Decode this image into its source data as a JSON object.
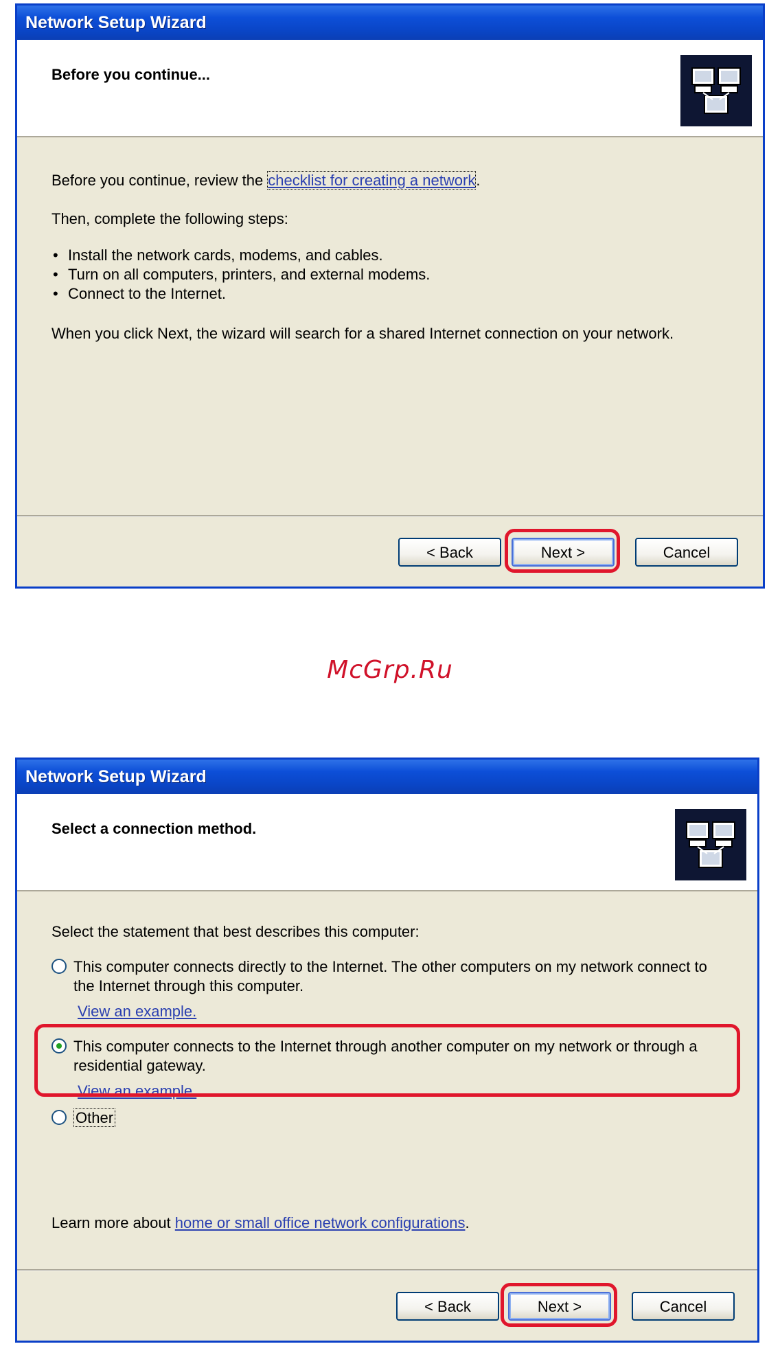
{
  "watermark": "McGrp.Ru",
  "dialog1": {
    "title": "Network Setup Wizard",
    "header": "Before you continue...",
    "intro_prefix": "Before you continue, review the ",
    "intro_link": "checklist for creating a network",
    "intro_suffix": ".",
    "steps_intro": "Then, complete the following steps:",
    "steps": [
      "Install the network cards, modems, and cables.",
      "Turn on all computers, printers, and external modems.",
      "Connect to the Internet."
    ],
    "note": "When you click Next, the wizard will search for a shared Internet connection on your network.",
    "buttons": {
      "back": "< Back",
      "next": "Next >",
      "cancel": "Cancel"
    }
  },
  "dialog2": {
    "title": "Network Setup Wizard",
    "header": "Select a connection method.",
    "prompt": "Select the statement that best describes this computer:",
    "options": [
      {
        "text": "This computer connects directly to the Internet. The other computers on my network connect to the Internet through this computer.",
        "link": "View an example.",
        "selected": false
      },
      {
        "text": "This computer connects to the Internet through another computer on my network or through a residential gateway.",
        "link": "View an example.",
        "selected": true
      },
      {
        "text": "Other",
        "selected": false
      }
    ],
    "learn_prefix": "Learn more about ",
    "learn_link": "home or small office network configurations",
    "learn_suffix": ".",
    "buttons": {
      "back": "< Back",
      "next": "Next >",
      "cancel": "Cancel"
    }
  },
  "colors": {
    "highlight": "#e0162c",
    "titlebar": "#0a46c8",
    "dialog_bg": "#ece9d8",
    "link": "#2a3fb0"
  }
}
